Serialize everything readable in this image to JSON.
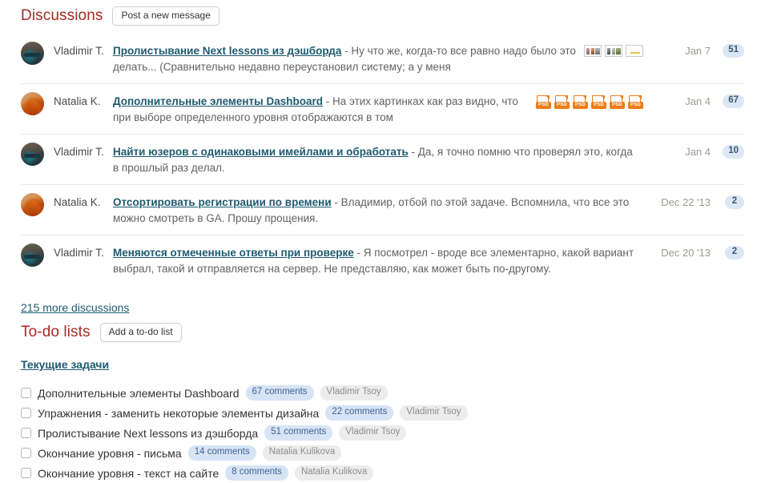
{
  "discussions": {
    "title": "Discussions",
    "new_message_button": "Post a new message",
    "more_link": "215 more discussions",
    "rows": [
      {
        "author": "Vladimir T.",
        "avatar": "avatar-vladimir",
        "title": "Пролистывание Next lessons из дэшборда",
        "excerpt": " - Ну что же, когда-то все равно надо было это делать... (Сравнительно недавно переустановил систему; а у меня",
        "attachments": [
          "thumbnail-1",
          "thumbnail-2",
          "thumbnail-3"
        ],
        "date": "Jan 7",
        "count": "51"
      },
      {
        "author": "Natalia K.",
        "avatar": "avatar-natalia",
        "title": "Дополнительные элементы Dashboard",
        "excerpt": " - На этих картинках как раз видно, что при выборе определенного уровня отображаются в том",
        "attachments": [
          "psd",
          "psd",
          "psd",
          "psd",
          "psd",
          "psd"
        ],
        "date": "Jan 4",
        "count": "67"
      },
      {
        "author": "Vladimir T.",
        "avatar": "avatar-vladimir",
        "title": "Найти юзеров с одинаковыми имейлами и обработать",
        "excerpt": " - Да, я точно помню что проверял это, когда в прошлый раз делал.",
        "attachments": [],
        "date": "Jan 4",
        "count": "10"
      },
      {
        "author": "Natalia K.",
        "avatar": "avatar-natalia",
        "title": "Отсортировать регистрации по времени",
        "excerpt": " - Владимир, отбой по этой задаче. Вспомнила, что все это можно смотреть в GA. Прошу прощения.",
        "attachments": [],
        "date": "Dec 22 '13",
        "count": "2"
      },
      {
        "author": "Vladimir T.",
        "avatar": "avatar-vladimir",
        "title": "Меняются отмеченные ответы при проверке",
        "excerpt": " - Я посмотрел - вроде все элементарно, какой вариант выбрал, такой и отправляется на сервер. Не представляю, как может быть по-другому.",
        "attachments": [],
        "date": "Dec 20 '13",
        "count": "2"
      }
    ]
  },
  "todo": {
    "title": "To-do lists",
    "add_button": "Add a to-do list",
    "list_name": "Текущие задачи",
    "items": [
      {
        "label": "Дополнительные элементы Dashboard",
        "comments": "67 comments",
        "assignee": "Vladimir Tsoy"
      },
      {
        "label": "Упражнения - заменить некоторые элементы дизайна",
        "comments": "22 comments",
        "assignee": "Vladimir Tsoy"
      },
      {
        "label": "Пролистывание Next lessons из дэшборда",
        "comments": "51 comments",
        "assignee": "Vladimir Tsoy"
      },
      {
        "label": "Окончание уровня - письма",
        "comments": "14 comments",
        "assignee": "Natalia Kulikova"
      },
      {
        "label": "Окончание уровня - текст на сайте",
        "comments": "8 comments",
        "assignee": "Natalia Kulikova"
      }
    ]
  },
  "icons": {
    "psd_label": "PSD"
  },
  "colors": {
    "heading": "#a62b24",
    "link": "#1e5a70",
    "badge_bg": "#dbe7f5",
    "badge_text": "#3c5a73",
    "comment_tag_bg": "#d7e4f6",
    "assignee_tag_bg": "#ececec",
    "psd_orange": "#ef7c18",
    "date_text": "#9c9a8f"
  }
}
